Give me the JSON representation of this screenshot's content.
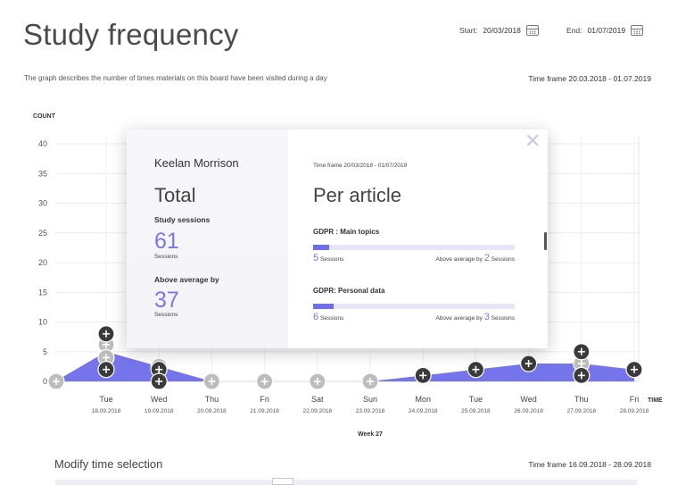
{
  "page": {
    "title": "Study frequency",
    "subtitle": "The graph describes the number of times materials on this board have been visited during a day",
    "timeframe": "Time frame 20.03.2018 - 01.07.2019",
    "start_label": "Start:",
    "start_value": "20/03/2018",
    "end_label": "End:",
    "end_value": "01/07/2019",
    "icons": {
      "calendar": "calendar-icon",
      "close": "close-icon",
      "add": "plus-icon"
    },
    "colors": {
      "accent": "#6f6dea",
      "area": "#7674ea",
      "marker_dark": "#3a3a3a",
      "marker_light": "#bdbdbd"
    }
  },
  "chart_data": {
    "type": "area",
    "ylabel": "COUNT",
    "xlabel": "TIME",
    "week_label": "Week 27",
    "ylim": [
      0,
      40
    ],
    "yticks": [
      "0",
      "5",
      "10",
      "15",
      "20",
      "25",
      "30",
      "35",
      "40"
    ],
    "grid": true,
    "categories": [
      {
        "day": "Tue",
        "date": "18.09.2018"
      },
      {
        "day": "Wed",
        "date": "19.09.2018"
      },
      {
        "day": "Thu",
        "date": "20.09.2018"
      },
      {
        "day": "Fri",
        "date": "21.09.2018"
      },
      {
        "day": "Sat",
        "date": "22.09.2018"
      },
      {
        "day": "Sun",
        "date": "23.09.2018"
      },
      {
        "day": "Mon",
        "date": "24.09.2018"
      },
      {
        "day": "Tue",
        "date": "25.09.2018"
      },
      {
        "day": "Wed",
        "date": "26.09.2018"
      },
      {
        "day": "Thu",
        "date": "27.09.2018"
      },
      {
        "day": "Fri",
        "date": "28.09.2018"
      }
    ],
    "series": [
      {
        "x": [
          -1,
          0,
          1,
          2,
          3,
          4,
          5,
          6,
          7,
          8,
          9,
          10
        ],
        "values": [
          0,
          5,
          2.5,
          0,
          0,
          0,
          0,
          1,
          2,
          3,
          3,
          2
        ]
      }
    ],
    "markers": [
      {
        "x": -1,
        "y": 0,
        "kind": "light"
      },
      {
        "x": 0,
        "y": 6,
        "kind": "dark"
      },
      {
        "x": 0,
        "y": 6.2,
        "kind": "light"
      },
      {
        "x": 0,
        "y": 8,
        "kind": "dark"
      },
      {
        "x": 0,
        "y": 4,
        "kind": "light"
      },
      {
        "x": 0,
        "y": 2,
        "kind": "dark"
      },
      {
        "x": 1,
        "y": 2.5,
        "kind": "light"
      },
      {
        "x": 1,
        "y": 2,
        "kind": "dark"
      },
      {
        "x": 1,
        "y": 0,
        "kind": "dark"
      },
      {
        "x": 2,
        "y": 0,
        "kind": "light"
      },
      {
        "x": 3,
        "y": 0,
        "kind": "light"
      },
      {
        "x": 4,
        "y": 0,
        "kind": "light"
      },
      {
        "x": 5,
        "y": 0,
        "kind": "light"
      },
      {
        "x": 6,
        "y": 1,
        "kind": "dark"
      },
      {
        "x": 7,
        "y": 2,
        "kind": "dark"
      },
      {
        "x": 8,
        "y": 3,
        "kind": "dark"
      },
      {
        "x": 9,
        "y": 3,
        "kind": "light"
      },
      {
        "x": 9,
        "y": 5,
        "kind": "dark"
      },
      {
        "x": 9,
        "y": 1,
        "kind": "dark"
      },
      {
        "x": 10,
        "y": 2,
        "kind": "dark"
      }
    ]
  },
  "popup": {
    "user_name": "Keelan Morrison",
    "total_heading": "Total",
    "study_sessions_label": "Study sessions",
    "study_sessions_value": "61",
    "study_sessions_unit": "Sessions",
    "above_avg_label": "Above average by",
    "above_avg_value": "37",
    "above_avg_unit": "Sessions",
    "timeframe": "Time frame 20/03/2018 - 01/07/2019",
    "per_article_heading": "Per article",
    "close_symbol": "✕",
    "articles": [
      {
        "title": "GDPR : Main topics",
        "progress": 0.08,
        "sessions": "5",
        "sessions_unit": "Sessions",
        "avg_prefix": "Above average by",
        "avg_value": "2",
        "avg_unit": "Sessions"
      },
      {
        "title": "GDPR: Personal data",
        "progress": 0.1,
        "sessions": "6",
        "sessions_unit": "Sessions",
        "avg_prefix": "Above average by",
        "avg_value": "3",
        "avg_unit": "Sessions"
      }
    ]
  },
  "selection": {
    "title": "Modify time selection",
    "timeframe": "Time frame 16.09.2018 - 28.09.2018"
  }
}
